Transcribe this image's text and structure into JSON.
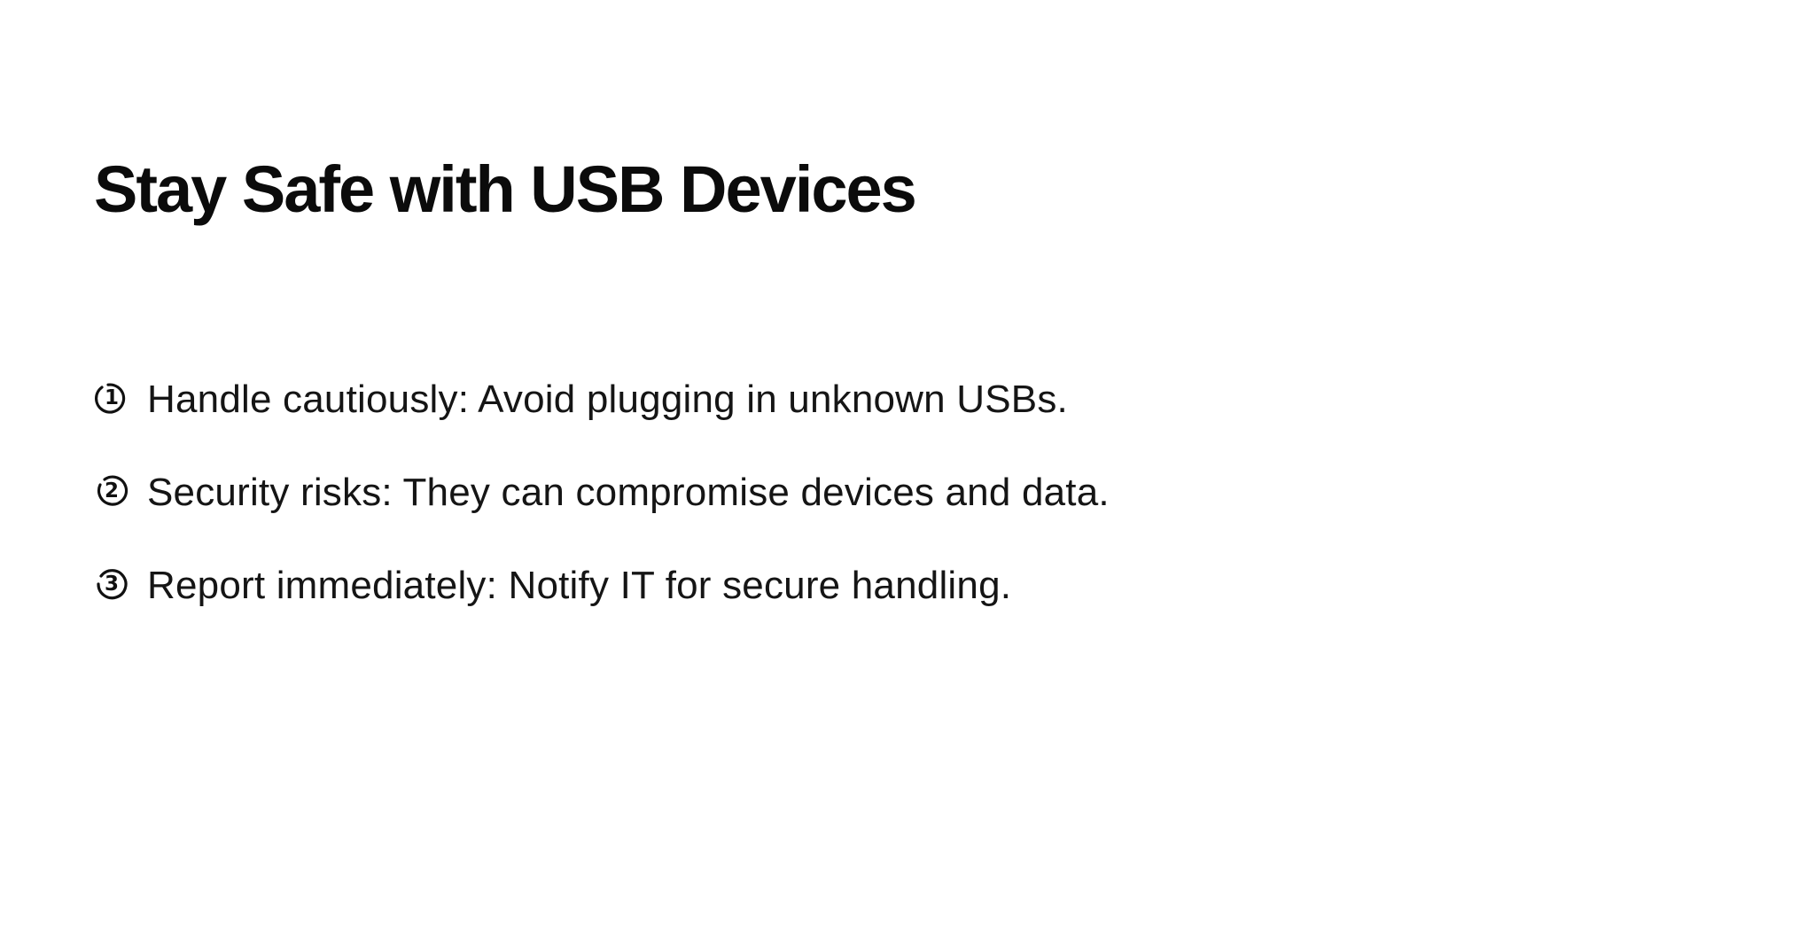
{
  "slide": {
    "title": "Stay Safe with USB Devices",
    "steps": [
      {
        "number": "1",
        "icon": "circled-number-1-icon",
        "text": "Handle cautiously: Avoid plugging in unknown USBs."
      },
      {
        "number": "2",
        "icon": "circled-number-2-icon",
        "text": "Security risks: They can compromise devices and data."
      },
      {
        "number": "3",
        "icon": "circled-number-3-icon",
        "text": "Report immediately: Notify IT for secure handling."
      }
    ]
  },
  "colors": {
    "background": "#ffffff",
    "text": "#111111"
  }
}
